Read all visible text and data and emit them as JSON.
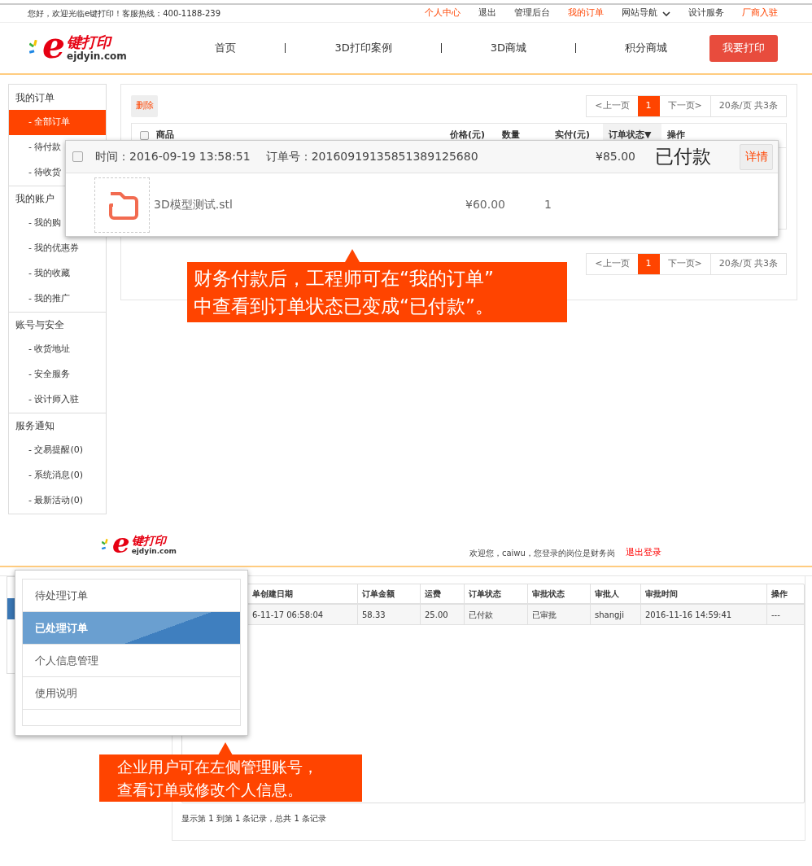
{
  "top_bar": {
    "greeting": "您好，欢迎光临e键打印！客服热线：400-1188-239",
    "links": [
      {
        "label": "个人中心",
        "highlight": true,
        "kind": "link"
      },
      {
        "label": "退出",
        "highlight": false,
        "kind": "link"
      },
      {
        "label": "管理后台",
        "highlight": false,
        "kind": "link"
      },
      {
        "label": "我的订单",
        "highlight": true,
        "kind": "link"
      },
      {
        "label": "网站导航",
        "highlight": false,
        "kind": "dropdown"
      },
      {
        "label": "设计服务",
        "highlight": false,
        "kind": "link"
      },
      {
        "label": "厂商入驻",
        "highlight": true,
        "kind": "link"
      }
    ]
  },
  "header": {
    "logo": {
      "mark": "e",
      "name": "键打印",
      "domain": "ejdyin.com"
    },
    "nav": [
      "首页",
      "3D打印案例",
      "3D商城",
      "积分商城"
    ],
    "cta": "我要打印"
  },
  "sidebar": {
    "groups": [
      {
        "title": "我的订单",
        "items": [
          {
            "label": "- 全部订单",
            "selected": true
          },
          {
            "label": "- 待付款",
            "selected": false
          },
          {
            "label": "- 待收货",
            "selected": false
          }
        ]
      },
      {
        "title": "我的账户",
        "items": [
          {
            "label": "- 我的购",
            "selected": false
          },
          {
            "label": "- 我的优惠券",
            "selected": false
          },
          {
            "label": "- 我的收藏",
            "selected": false
          },
          {
            "label": "- 我的推广",
            "selected": false
          }
        ]
      },
      {
        "title": "账号与安全",
        "items": [
          {
            "label": "- 收货地址",
            "selected": false
          },
          {
            "label": "- 安全服务",
            "selected": false
          },
          {
            "label": "- 设计师入驻",
            "selected": false
          }
        ]
      },
      {
        "title": "服务通知",
        "items": [
          {
            "label": "- 交易提醒(0)",
            "selected": false
          },
          {
            "label": "- 系统消息(0)",
            "selected": false
          },
          {
            "label": "- 最新活动(0)",
            "selected": false
          }
        ]
      }
    ]
  },
  "orders_panel": {
    "delete_button": "删除",
    "pagination_top": {
      "prev": "<上一页",
      "pages": [
        {
          "label": "1",
          "selected": true
        }
      ],
      "next": "下一页>",
      "summary": "20条/页 共3条"
    },
    "select_all_checked": false,
    "columns": [
      "商品",
      "价格(元)",
      "数量",
      "实付(元)",
      "订单状态▼",
      "操作"
    ],
    "pagination_bottom": {
      "prev": "<上一页",
      "pages": [
        {
          "label": "1",
          "selected": true
        }
      ],
      "next": "下一页>",
      "summary": "20条/页 共3条"
    }
  },
  "order_popup": {
    "checked": false,
    "time": "时间：2016-09-19 13:58:51",
    "order_no": "订单号：20160919135851389125680",
    "total": "¥85.00",
    "status": "已付款",
    "detail_button": "详情",
    "items": [
      {
        "name": "3D模型测试.stl",
        "price": "¥60.00",
        "quantity": "1"
      }
    ]
  },
  "callout_1": {
    "lines": [
      "财务付款后，工程师可在“我的订单”",
      "中查看到订单状态已变成“已付款”。"
    ]
  },
  "admin": {
    "logo": {
      "mark": "e",
      "name": "键打印",
      "domain": "ejdyin.com"
    },
    "welcome": "欢迎您，caiwu，您登录的岗位是财务岗",
    "logout": "退出登录",
    "menu": [
      {
        "label": "待处理订单",
        "selected": false
      },
      {
        "label": "已处理订单",
        "selected": true
      },
      {
        "label": "个人信息管理",
        "selected": false
      },
      {
        "label": "使用说明",
        "selected": false
      }
    ],
    "table": {
      "columns": [
        "单创建日期",
        "订单金额",
        "运费",
        "订单状态",
        "审批状态",
        "审批人",
        "审批时间",
        "操作"
      ],
      "rows": [
        [
          "6-11-17 06:58:04",
          "58.33",
          "25.00",
          "已付款",
          "已审批",
          "shangji",
          "2016-11-16 14:59:41",
          "---"
        ]
      ]
    },
    "footer": "显示第 1 到第 1 条记录，总共 1 条记录"
  },
  "callout_2": {
    "lines": [
      "企业用户可在左侧管理账号，",
      "查看订单或修改个人信息。"
    ]
  }
}
